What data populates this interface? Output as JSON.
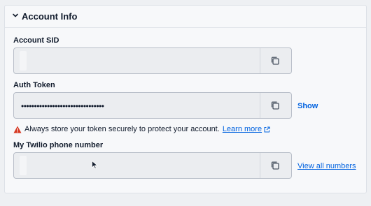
{
  "section": {
    "title": "Account Info"
  },
  "account_sid": {
    "label": "Account SID",
    "value": ""
  },
  "auth_token": {
    "label": "Auth Token",
    "value": "••••••••••••••••••••••••••••••••",
    "show_label": "Show"
  },
  "warning": {
    "text": "Always store your token securely to protect your account.",
    "learn_more": "Learn more"
  },
  "phone": {
    "label": "My Twilio phone number",
    "value": "",
    "view_all": "View all numbers"
  },
  "colors": {
    "link": "#0263e0",
    "warning": "#d6361f"
  }
}
